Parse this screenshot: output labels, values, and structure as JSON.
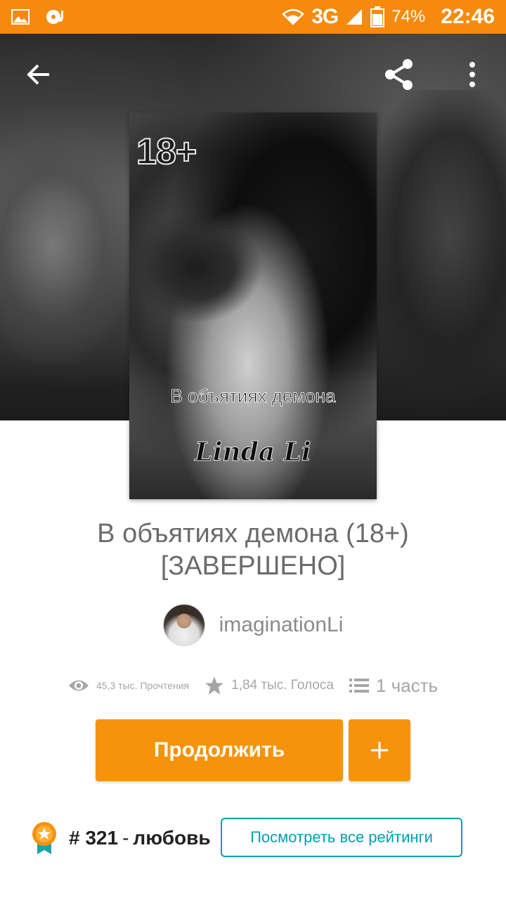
{
  "status_bar": {
    "network": "3G",
    "battery_percent": "74%",
    "time": "22:46"
  },
  "cover": {
    "age_badge": "18+",
    "title_text": "В объятиях демона",
    "author_text": "Linda Li"
  },
  "story": {
    "title": "В объятиях демона (18+) [ЗАВЕРШЕНО]",
    "author": "imaginationLi"
  },
  "stats": {
    "reads": "45,3 тыс. Прочтения",
    "votes": "1,84 тыс. Голоса",
    "parts": "1 часть"
  },
  "actions": {
    "continue_label": "Продолжить",
    "add_label": "+"
  },
  "ranking": {
    "hash": "#",
    "rank": "321",
    "category": "любовь",
    "all_ratings_label": "Посмотреть все рейтинги"
  },
  "colors": {
    "accent_orange": "#f6930c",
    "status_bar": "#f68a0c",
    "teal": "#00a0b0"
  }
}
